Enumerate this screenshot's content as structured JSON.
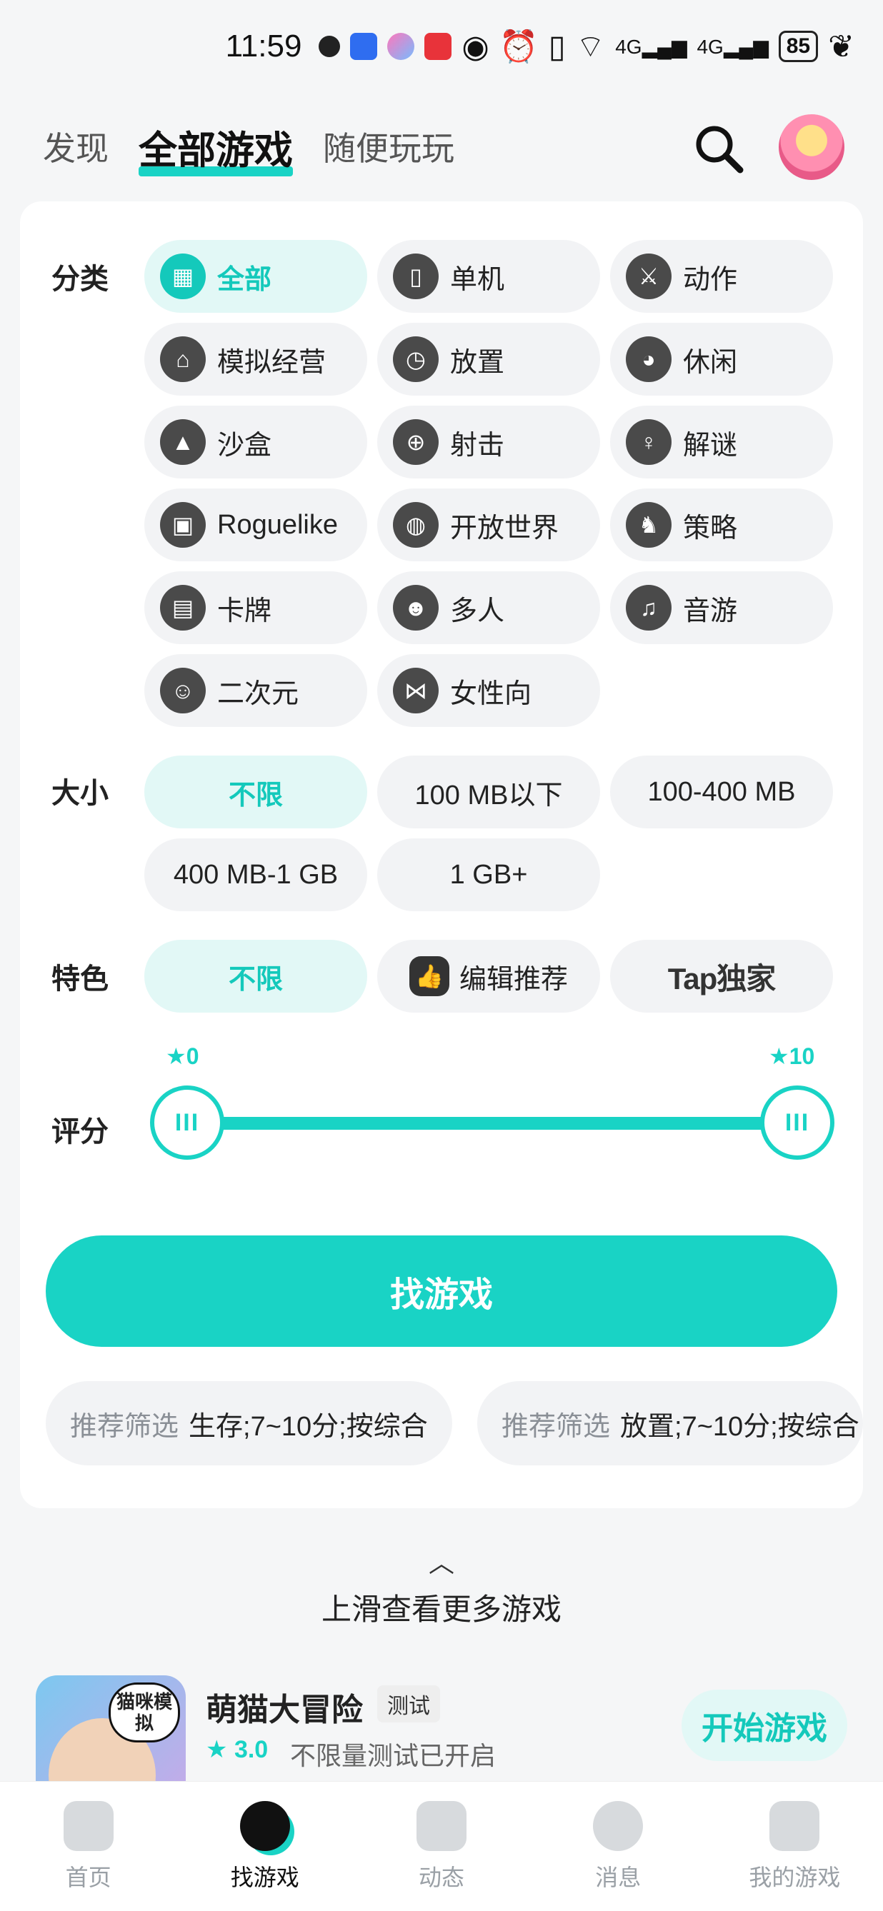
{
  "status_bar": {
    "time": "11:59",
    "battery": "85"
  },
  "top_tabs": [
    {
      "label": "发现"
    },
    {
      "label": "全部游戏"
    },
    {
      "label": "随便玩玩"
    }
  ],
  "filters": {
    "category": {
      "label": "分类",
      "options": [
        {
          "label": "全部",
          "icon": "grid-icon"
        },
        {
          "label": "单机",
          "icon": "gameboy-icon"
        },
        {
          "label": "动作",
          "icon": "sword-icon"
        },
        {
          "label": "模拟经营",
          "icon": "shop-icon"
        },
        {
          "label": "放置",
          "icon": "stopwatch-icon"
        },
        {
          "label": "休闲",
          "icon": "pacman-icon"
        },
        {
          "label": "沙盒",
          "icon": "sandbox-icon"
        },
        {
          "label": "射击",
          "icon": "crosshair-icon"
        },
        {
          "label": "解谜",
          "icon": "key-icon"
        },
        {
          "label": "Roguelike",
          "icon": "map-icon"
        },
        {
          "label": "开放世界",
          "icon": "globe-icon"
        },
        {
          "label": "策略",
          "icon": "chess-knight-icon"
        },
        {
          "label": "卡牌",
          "icon": "cards-icon"
        },
        {
          "label": "多人",
          "icon": "people-icon"
        },
        {
          "label": "音游",
          "icon": "music-note-icon"
        },
        {
          "label": "二次元",
          "icon": "anime-girl-icon"
        },
        {
          "label": "女性向",
          "icon": "bow-icon"
        }
      ]
    },
    "size": {
      "label": "大小",
      "options": [
        "不限",
        "100 MB以下",
        "100-400 MB",
        "400 MB-1 GB",
        "1 GB+"
      ]
    },
    "feature": {
      "label": "特色",
      "options": [
        "不限",
        "编辑推荐",
        "Tap独家"
      ]
    },
    "rating": {
      "label": "评分",
      "min": "0",
      "max": "10",
      "handle_glyph": "III"
    }
  },
  "find_button": "找游戏",
  "presets": [
    {
      "label": "推荐筛选",
      "value": "生存;7~10分;按综合"
    },
    {
      "label": "推荐筛选",
      "value": "放置;7~10分;按综合"
    }
  ],
  "more_hint": {
    "chevron": "︿",
    "text": "上滑查看更多游戏"
  },
  "game": {
    "title": "萌猫大冒险",
    "tag": "测试",
    "rating": "3.0",
    "desc": "不限量测试已开启",
    "badge": "猫咪模拟",
    "play": "开始游戏"
  },
  "bottom_nav": [
    {
      "label": "首页"
    },
    {
      "label": "找游戏"
    },
    {
      "label": "动态"
    },
    {
      "label": "消息"
    },
    {
      "label": "我的游戏"
    }
  ],
  "colors": {
    "accent": "#19d3c5",
    "chip_bg": "#f2f3f5",
    "selected_bg": "#e2f8f6"
  }
}
